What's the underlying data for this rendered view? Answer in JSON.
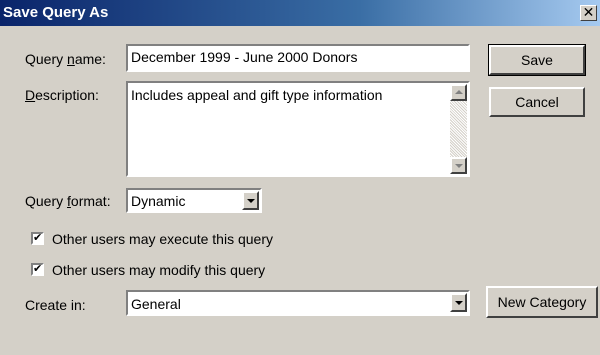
{
  "window": {
    "title": "Save Query As",
    "close_symbol": "✕"
  },
  "query_name": {
    "label_before": "Query ",
    "label_mnemonic": "n",
    "label_after": "ame:",
    "value": "December 1999 - June 2000 Donors"
  },
  "description": {
    "label_mnemonic": "D",
    "label_after": "escription:",
    "value": "Includes appeal and gift type information"
  },
  "query_format": {
    "label_before": "Query ",
    "label_mnemonic": "f",
    "label_after": "ormat:",
    "value": "Dynamic"
  },
  "options": {
    "execute": {
      "label": "Other users may execute this query",
      "checked": true
    },
    "modify": {
      "label": "Other users may modify this query",
      "checked": true
    }
  },
  "create_in": {
    "label": "Create in:",
    "value": "General"
  },
  "buttons": {
    "save": "Save",
    "cancel": "Cancel",
    "new_category": "New Category"
  },
  "check_mark": "✔",
  "colors": {
    "dialog_bg": "#d4d0c8",
    "title_gradient_start": "#0a246a",
    "title_gradient_end": "#a6caf0"
  }
}
